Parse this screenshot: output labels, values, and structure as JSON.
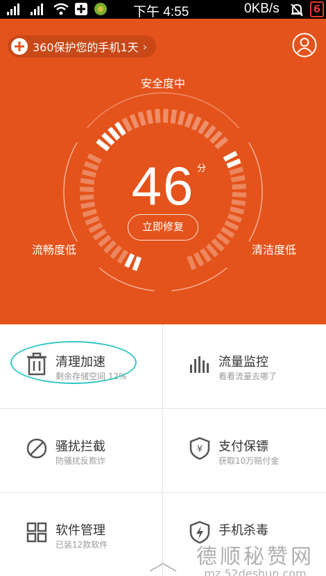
{
  "status_bar": {
    "time": "下午 4:55",
    "network_speed": "0KB/s",
    "battery": "6",
    "icons": [
      "signal-icon",
      "signal-icon",
      "wifi-icon",
      "plus-box-icon",
      "app-notification-icon",
      "bell-muted-icon",
      "battery-icon"
    ]
  },
  "hero": {
    "protect_text": "360保护您的手机1天",
    "safety_label": "安全度中",
    "score": "46",
    "score_unit": "分",
    "repair_button": "立即修复",
    "left_metric": "流畅度低",
    "right_metric": "清洁度低",
    "background_color": "#e4531b"
  },
  "features": [
    {
      "title": "清理加速",
      "subtitle": "剩余存储空间 12%",
      "icon": "trash-icon"
    },
    {
      "title": "流量监控",
      "subtitle": "看看流量去哪了",
      "icon": "bar-chart-icon"
    },
    {
      "title": "骚扰拦截",
      "subtitle": "防骚扰反欺诈",
      "icon": "block-icon"
    },
    {
      "title": "支付保镖",
      "subtitle": "获取10万赔付金",
      "icon": "yuan-shield-icon"
    },
    {
      "title": "软件管理",
      "subtitle": "已装12款软件",
      "icon": "apps-grid-icon"
    },
    {
      "title": "手机杀毒",
      "subtitle": "",
      "icon": "lightning-shield-icon"
    }
  ],
  "watermark": {
    "text": "德顺秘赞网",
    "url": "mz.52deshun.com"
  },
  "highlight_color": "#2fc6c6"
}
